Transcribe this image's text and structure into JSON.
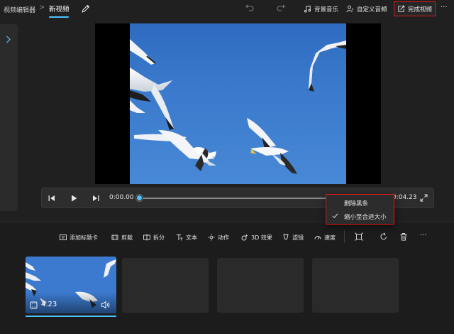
{
  "header": {
    "app_title": "视频编辑器",
    "breadcrumb_sep": ">",
    "project_title": "新视频",
    "background_music_label": "背景音乐",
    "custom_audio_label": "自定义音频",
    "finish_video_label": "完成视频",
    "more_label": "···"
  },
  "player": {
    "current_time": "0:00.00",
    "end_time": "0:04.23",
    "progress": 0
  },
  "context_menu": {
    "items": [
      {
        "label": "删除黑条",
        "checked": false
      },
      {
        "label": "缩小至合适大小",
        "checked": true
      }
    ]
  },
  "storyboard_toolbar": {
    "add_title_card": "添加标题卡",
    "trim": "剪裁",
    "split": "拆分",
    "text": "文本",
    "motion": "动作",
    "effects_3d": "3D 效果",
    "filters": "滤镜",
    "speed": "速度",
    "more_label": "···"
  },
  "clips": [
    {
      "duration": "4.23",
      "selected": true,
      "has_audio": true
    }
  ],
  "colors": {
    "accent": "#4cc2ff",
    "highlight_box": "#e01818",
    "background": "#202020",
    "sky": "#3a79cc"
  },
  "icons": {
    "edit": "pencil-icon",
    "undo": "undo-icon",
    "redo": "redo-icon",
    "music": "music-note-icon",
    "custom_audio": "person-audio-icon",
    "export": "share-icon",
    "expand": "expand-icon",
    "check": "checkmark-icon"
  }
}
